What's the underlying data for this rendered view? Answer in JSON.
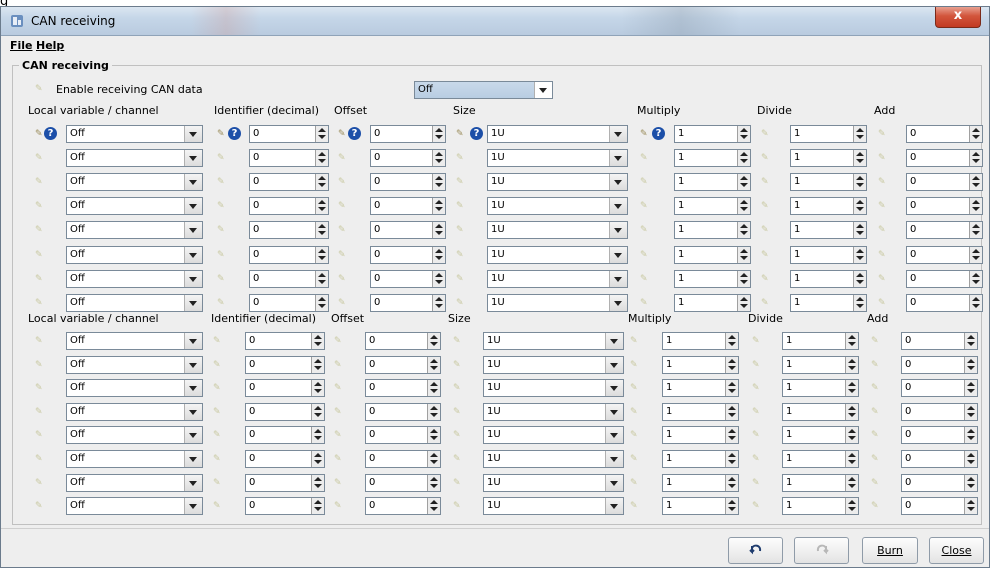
{
  "stray_label": "g",
  "window": {
    "title": "CAN receiving",
    "close_glyph": "x"
  },
  "menu": {
    "file_label": "File",
    "help_label": "Help"
  },
  "panel": {
    "title": "CAN receiving",
    "enable_label": "Enable receiving CAN data",
    "enable_value": "Off"
  },
  "headers": {
    "local_variable": "Local variable / channel",
    "identifier": "Identifier (decimal)",
    "offset": "Offset",
    "size": "Size",
    "multiply": "Multiply",
    "divide": "Divide",
    "add": "Add"
  },
  "help_glyph": "?",
  "section1_rows": [
    {
      "channel": "Off",
      "identifier": "0",
      "offset": "0",
      "size": "1U",
      "multiply": "1",
      "divide": "1",
      "add": "0"
    },
    {
      "channel": "Off",
      "identifier": "0",
      "offset": "0",
      "size": "1U",
      "multiply": "1",
      "divide": "1",
      "add": "0"
    },
    {
      "channel": "Off",
      "identifier": "0",
      "offset": "0",
      "size": "1U",
      "multiply": "1",
      "divide": "1",
      "add": "0"
    },
    {
      "channel": "Off",
      "identifier": "0",
      "offset": "0",
      "size": "1U",
      "multiply": "1",
      "divide": "1",
      "add": "0"
    },
    {
      "channel": "Off",
      "identifier": "0",
      "offset": "0",
      "size": "1U",
      "multiply": "1",
      "divide": "1",
      "add": "0"
    },
    {
      "channel": "Off",
      "identifier": "0",
      "offset": "0",
      "size": "1U",
      "multiply": "1",
      "divide": "1",
      "add": "0"
    },
    {
      "channel": "Off",
      "identifier": "0",
      "offset": "0",
      "size": "1U",
      "multiply": "1",
      "divide": "1",
      "add": "0"
    },
    {
      "channel": "Off",
      "identifier": "0",
      "offset": "0",
      "size": "1U",
      "multiply": "1",
      "divide": "1",
      "add": "0"
    }
  ],
  "section2_rows": [
    {
      "channel": "Off",
      "identifier": "0",
      "offset": "0",
      "size": "1U",
      "multiply": "1",
      "divide": "1",
      "add": "0"
    },
    {
      "channel": "Off",
      "identifier": "0",
      "offset": "0",
      "size": "1U",
      "multiply": "1",
      "divide": "1",
      "add": "0"
    },
    {
      "channel": "Off",
      "identifier": "0",
      "offset": "0",
      "size": "1U",
      "multiply": "1",
      "divide": "1",
      "add": "0"
    },
    {
      "channel": "Off",
      "identifier": "0",
      "offset": "0",
      "size": "1U",
      "multiply": "1",
      "divide": "1",
      "add": "0"
    },
    {
      "channel": "Off",
      "identifier": "0",
      "offset": "0",
      "size": "1U",
      "multiply": "1",
      "divide": "1",
      "add": "0"
    },
    {
      "channel": "Off",
      "identifier": "0",
      "offset": "0",
      "size": "1U",
      "multiply": "1",
      "divide": "1",
      "add": "0"
    },
    {
      "channel": "Off",
      "identifier": "0",
      "offset": "0",
      "size": "1U",
      "multiply": "1",
      "divide": "1",
      "add": "0"
    },
    {
      "channel": "Off",
      "identifier": "0",
      "offset": "0",
      "size": "1U",
      "multiply": "1",
      "divide": "1",
      "add": "0"
    }
  ],
  "footer": {
    "undo_icon": "undo-icon",
    "redo_icon": "redo-icon",
    "burn_label": "Burn",
    "close_label": "Close"
  },
  "colors": {
    "title_bar": "#c5d6e8",
    "help_icon": "#1c4fa8",
    "close_button": "#c23a22",
    "selection_combo": "#c9d9ea"
  }
}
